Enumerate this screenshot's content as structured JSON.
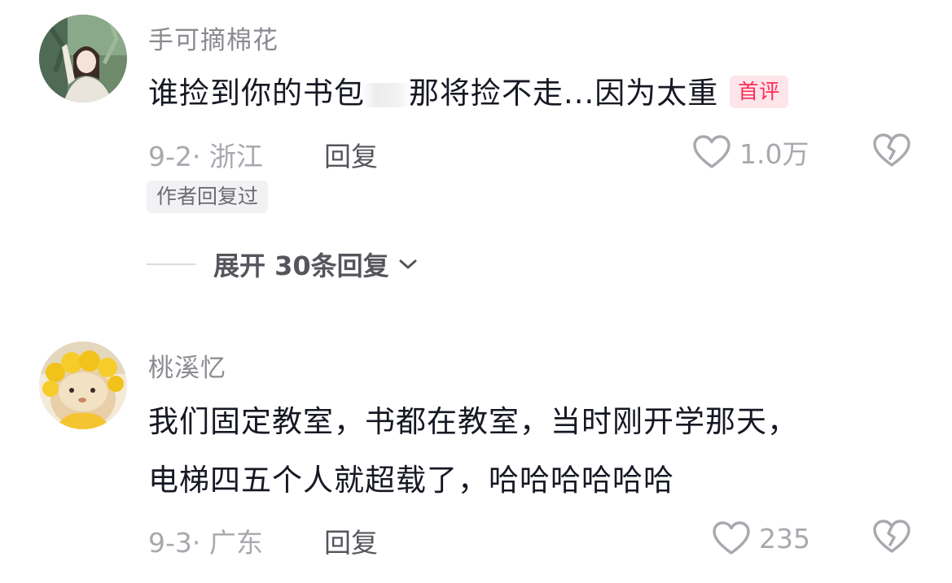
{
  "comments": [
    {
      "username": "手可摘棉花",
      "text_before": "谁捡到你的书包",
      "text_after": "那将捡不走...因为太重",
      "badge": "首评",
      "date_location": "9-2· 浙江",
      "reply_label": "回复",
      "like_count": "1.0万",
      "author_tag": "作者回复过",
      "expand_label": "展开 30条回复"
    },
    {
      "username": "桃溪忆",
      "text_line1": "我们固定教室，书都在教室，当时刚开学那天，",
      "text_line2": "电梯四五个人就超载了，哈哈哈哈哈哈",
      "date_location": "9-3· 广东",
      "reply_label": "回复",
      "like_count": "235"
    }
  ],
  "icons": {
    "like": "heart-outline-icon",
    "dislike": "broken-heart-icon",
    "expand": "chevron-down-icon"
  },
  "colors": {
    "badge_text": "#fe2c55",
    "badge_bg": "#fde5ea",
    "muted": "#a8a9ae"
  }
}
